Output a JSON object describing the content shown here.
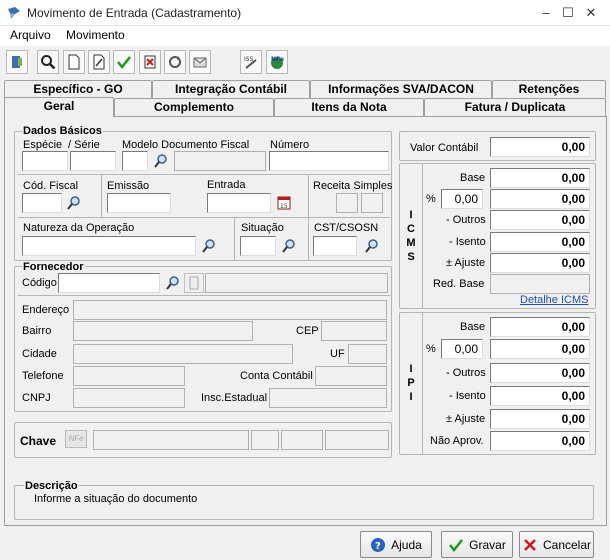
{
  "window": {
    "title": "Movimento de Entrada (Cadastramento)",
    "minimize": "–",
    "maximize": "☐",
    "close": "✕"
  },
  "menu": {
    "arquivo": "Arquivo",
    "movimento": "Movimento"
  },
  "tabs_back": [
    "Específico - GO",
    "Integração Contábil",
    "Informações SVA/DACON",
    "Retenções"
  ],
  "tabs_front": [
    "Geral",
    "Complemento",
    "Itens da Nota",
    "Fatura / Duplicata"
  ],
  "dados": {
    "title": "Dados Básicos",
    "especie": "Espécie",
    "serie": "/ Série",
    "modelo": "Modelo Documento Fiscal",
    "numero": "Número",
    "cod_fiscal": "Cód. Fiscal",
    "emissao": "Emissão",
    "entrada": "Entrada",
    "receita_simples": "Receita Simples",
    "natureza": "Natureza da Operação",
    "situacao": "Situação",
    "cst": "CST/CSOSN"
  },
  "fornecedor": {
    "title": "Fornecedor",
    "codigo": "Código",
    "endereco": "Endereço",
    "bairro": "Bairro",
    "cep": "CEP",
    "cidade": "Cidade",
    "uf": "UF",
    "telefone": "Telefone",
    "conta_contabil": "Conta Contábil",
    "cnpj": "CNPJ",
    "insc_estadual": "Insc.Estadual"
  },
  "chave": {
    "label": "Chave",
    "nfe_badge": "NFe"
  },
  "valores": {
    "valor_contabil_label": "Valor Contábil",
    "valor_contabil": "0,00",
    "icms_label": "I C M S",
    "icms": {
      "base_l": "Base",
      "base": "0,00",
      "pct_l": "%",
      "pct": "0,00",
      "pct_val": "0,00",
      "outros_l": "- Outros",
      "outros": "0,00",
      "isento_l": "- Isento",
      "isento": "0,00",
      "ajuste_l": "± Ajuste",
      "ajuste": "0,00",
      "red_l": "Red. Base"
    },
    "detalhe_icms": "Detalhe ICMS",
    "ipi_label": "I P I",
    "ipi": {
      "base_l": "Base",
      "base": "0,00",
      "pct_l": "%",
      "pct": "0,00",
      "pct_val": "0,00",
      "outros_l": "- Outros",
      "outros": "0,00",
      "isento_l": "- Isento",
      "isento": "0,00",
      "ajuste_l": "± Ajuste",
      "ajuste": "0,00",
      "nao_l": "Não Aprov.",
      "nao": "0,00"
    }
  },
  "descricao": {
    "title": "Descrição",
    "text": "Informe a situação do documento"
  },
  "buttons": {
    "ajuda": "Ajuda",
    "gravar": "Gravar",
    "cancelar": "Cancelar"
  },
  "colors": {
    "accent": "#1a4fb5",
    "ok": "#1a9a1a",
    "cancel": "#d01818"
  }
}
